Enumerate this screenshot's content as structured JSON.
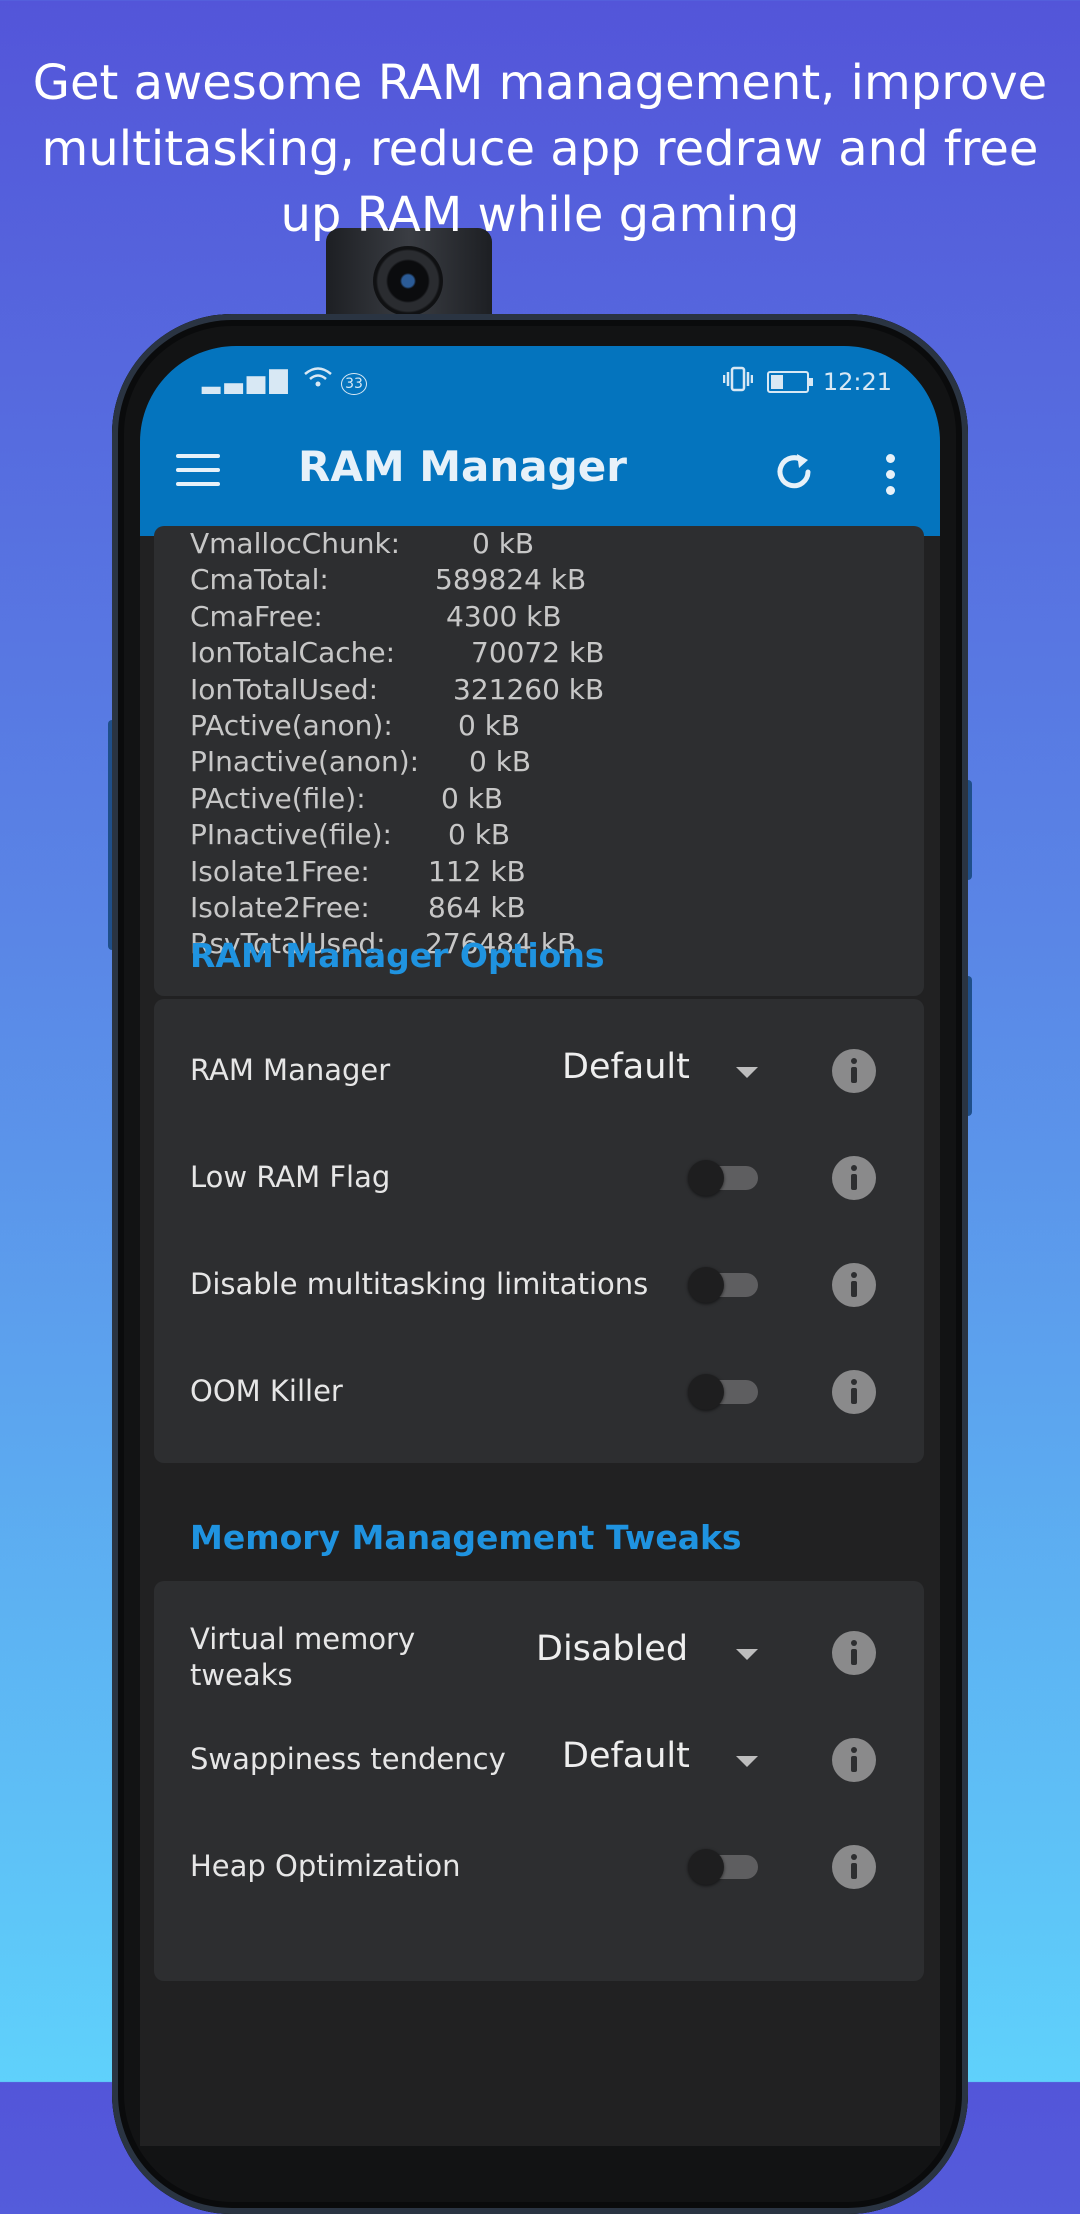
{
  "headline": "Get awesome RAM management, improve multitasking, reduce app redraw and free up RAM while gaming",
  "statusbar": {
    "signal": "▂▃▅▇",
    "wifi_badge": "33",
    "time": "12:21"
  },
  "appbar": {
    "title": "RAM Manager",
    "menu_icon": "hamburger-icon",
    "refresh_icon": "refresh-icon",
    "more_icon": "more-vert-icon"
  },
  "meminfo": [
    {
      "key": "VmallocChunk:",
      "value": "0 kB"
    },
    {
      "key": "CmaTotal:",
      "value": "589824 kB"
    },
    {
      "key": "CmaFree:",
      "value": "4300 kB"
    },
    {
      "key": "IonTotalCache:",
      "value": "70072 kB"
    },
    {
      "key": "IonTotalUsed:",
      "value": "321260 kB"
    },
    {
      "key": "PActive(anon):",
      "value": "0 kB"
    },
    {
      "key": "PInactive(anon):",
      "value": "0 kB"
    },
    {
      "key": "PActive(file):",
      "value": "0 kB"
    },
    {
      "key": "PInactive(file):",
      "value": "0 kB"
    },
    {
      "key": "Isolate1Free:",
      "value": "112 kB"
    },
    {
      "key": "Isolate2Free:",
      "value": "864 kB"
    },
    {
      "key": "RsvTotalUsed:",
      "value": "276484 kB"
    }
  ],
  "ram_options": {
    "title": "RAM Manager Options",
    "items": [
      {
        "label": "RAM Manager",
        "type": "dropdown",
        "value": "Default"
      },
      {
        "label": "Low RAM Flag",
        "type": "toggle",
        "on": false
      },
      {
        "label": "Disable multitasking limitations",
        "type": "toggle",
        "on": false
      },
      {
        "label": "OOM Killer",
        "type": "toggle",
        "on": false
      }
    ]
  },
  "memory_tweaks": {
    "title": "Memory Management Tweaks",
    "items": [
      {
        "label": "Virtual memory tweaks",
        "label_line1": "Virtual memory",
        "label_line2": "tweaks",
        "type": "dropdown",
        "value": "Disabled"
      },
      {
        "label": "Swappiness tendency",
        "type": "dropdown",
        "value": "Default"
      },
      {
        "label": "Heap Optimization",
        "type": "toggle",
        "on": false
      }
    ]
  },
  "colors": {
    "appbar": "#0474be",
    "accent": "#1f93e0",
    "card": "#2d2e30",
    "screen_bg": "#212122"
  }
}
